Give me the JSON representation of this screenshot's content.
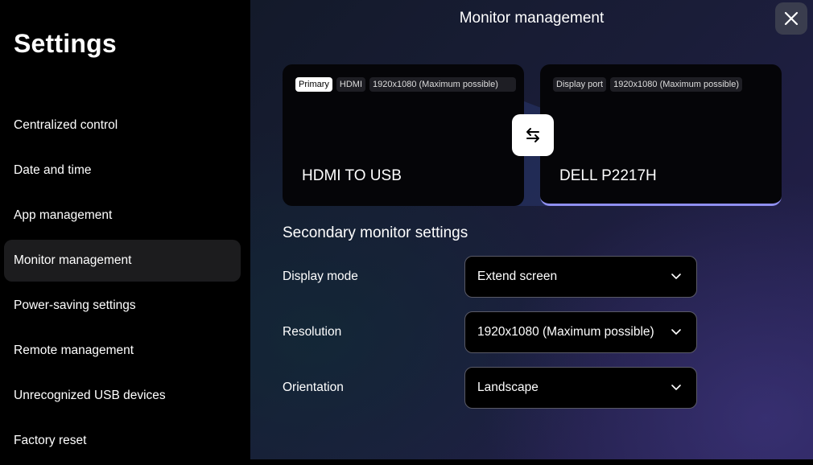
{
  "sidebar": {
    "title": "Settings",
    "items": [
      {
        "label": "Centralized control"
      },
      {
        "label": "Date and time"
      },
      {
        "label": "App management"
      },
      {
        "label": "Monitor management",
        "active": true
      },
      {
        "label": "Power-saving settings"
      },
      {
        "label": "Remote management"
      },
      {
        "label": "Unrecognized USB devices"
      },
      {
        "label": "Factory reset"
      }
    ]
  },
  "main": {
    "title": "Monitor management",
    "close_icon": "close-icon",
    "monitors": [
      {
        "badge_primary": "Primary",
        "badge_port": "HDMI",
        "badge_resolution": "1920x1080 (Maximum possible)",
        "name": "HDMI TO USB"
      },
      {
        "badge_port": "Display port",
        "badge_resolution": "1920x1080 (Maximum possible)",
        "name": "DELL P2217H"
      }
    ],
    "swap_icon": "swap-arrows-icon",
    "secondary": {
      "title": "Secondary monitor settings",
      "display_mode": {
        "label": "Display mode",
        "value": "Extend screen"
      },
      "resolution": {
        "label": "Resolution",
        "value": "1920x1080 (Maximum possible)"
      },
      "orientation": {
        "label": "Orientation",
        "value": "Landscape"
      }
    }
  },
  "colors": {
    "accent": "#8f8ff0",
    "sidebar_active": "#1c1c1e"
  }
}
